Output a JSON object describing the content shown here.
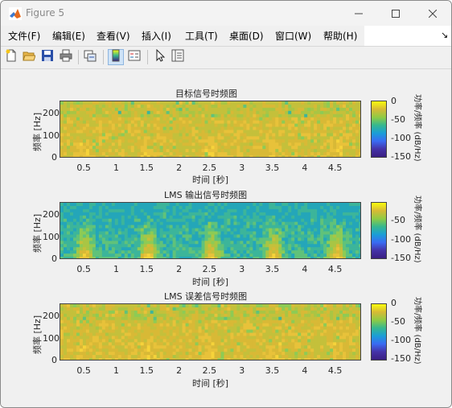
{
  "window": {
    "title": "Figure 5"
  },
  "menu": [
    {
      "label": "文件(F)"
    },
    {
      "label": "编辑(E)"
    },
    {
      "label": "查看(V)"
    },
    {
      "label": "插入(I)"
    },
    {
      "label": "工具(T)"
    },
    {
      "label": "桌面(D)"
    },
    {
      "label": "窗口(W)"
    },
    {
      "label": "帮助(H)"
    }
  ],
  "menu_overflow_icon": "arrow-overflow-icon",
  "toolbar": {
    "icons": [
      "new-figure-icon",
      "open-file-icon",
      "save-icon",
      "print-icon",
      "link-plot-icon",
      "insert-colorbar-icon",
      "insert-legend-icon",
      "edit-plot-icon",
      "property-inspector-icon"
    ]
  },
  "chart_data": [
    {
      "type": "heatmap",
      "title": "目标信号时频图",
      "xlabel": "时间 [秒]",
      "ylabel": "频率 [Hz]",
      "xticks": [
        "0.5",
        "1",
        "1.5",
        "2",
        "2.5",
        "3",
        "3.5",
        "4",
        "4.5"
      ],
      "yticks": [
        "0",
        "100",
        "200"
      ],
      "xlim": [
        0.1,
        4.9
      ],
      "ylim": [
        0,
        250
      ],
      "colorbar": {
        "label": "功率/频率 (dB/Hz)",
        "ticks": [
          "0",
          "-50",
          "-100",
          "-150"
        ],
        "range": [
          -150,
          0
        ]
      },
      "colormap": "parula",
      "pattern": "uniform"
    },
    {
      "type": "heatmap",
      "title": "LMS 输出信号时频图",
      "xlabel": "时间 [秒]",
      "ylabel": "频率 [Hz]",
      "xticks": [
        "0.5",
        "1",
        "1.5",
        "2",
        "2.5",
        "3",
        "3.5",
        "4",
        "4.5"
      ],
      "yticks": [
        "0",
        "100",
        "200"
      ],
      "xlim": [
        0.1,
        4.9
      ],
      "ylim": [
        0,
        250
      ],
      "colorbar": {
        "label": "功率/频率 (dB/Hz)",
        "ticks": [
          "-50",
          "-100",
          "-150"
        ],
        "range": [
          -160,
          -20
        ]
      },
      "colormap": "parula",
      "pattern": "bursts"
    },
    {
      "type": "heatmap",
      "title": "LMS 误差信号时频图",
      "xlabel": "时间 [秒]",
      "ylabel": "频率 [Hz]",
      "xticks": [
        "0.5",
        "1",
        "1.5",
        "2",
        "2.5",
        "3",
        "3.5",
        "4",
        "4.5"
      ],
      "yticks": [
        "0",
        "100",
        "200"
      ],
      "xlim": [
        0.1,
        4.9
      ],
      "ylim": [
        0,
        250
      ],
      "colorbar": {
        "label": "功率/频率 (dB/Hz)",
        "ticks": [
          "0",
          "-50",
          "-100",
          "-150"
        ],
        "range": [
          -150,
          0
        ]
      },
      "colormap": "parula",
      "pattern": "uniform"
    }
  ]
}
